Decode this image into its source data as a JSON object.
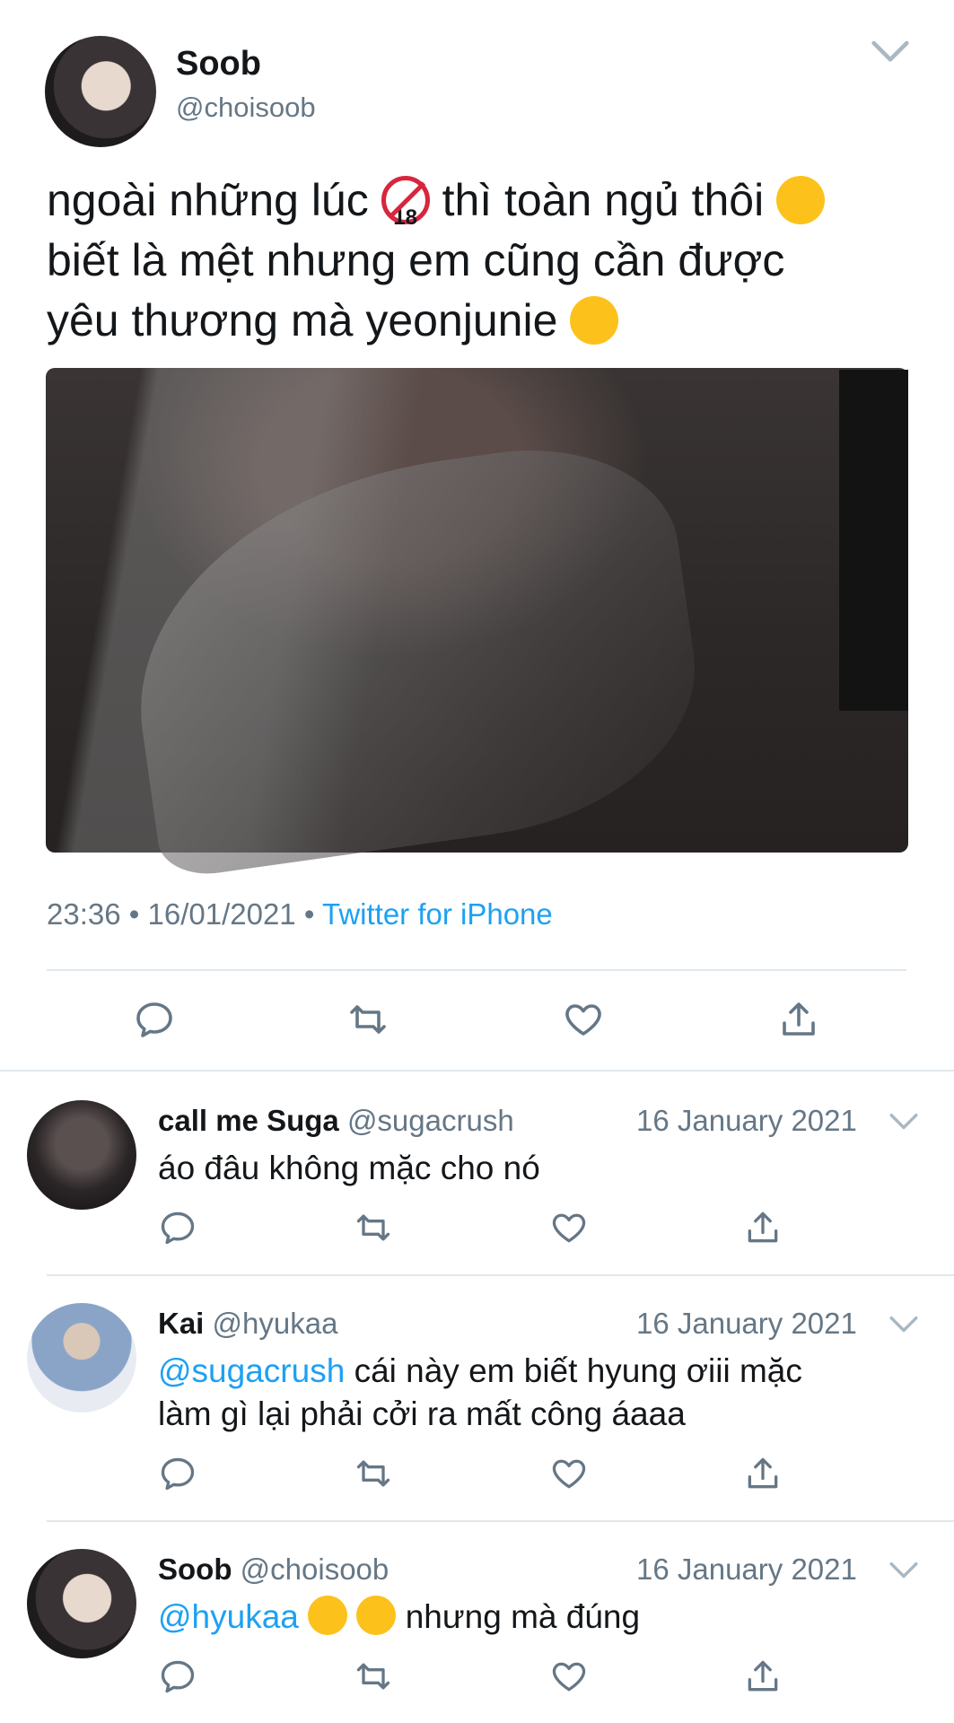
{
  "main_tweet": {
    "display_name": "Soob",
    "handle": "@choisoob",
    "text_line1_a": "ngoài những lúc",
    "text_line1_b": "thì toàn ngủ thôi",
    "text_line2": "biết là mệt nhưng em cũng cần được",
    "text_line3": "yêu thương mà yeonjunie",
    "emoji_18": "18",
    "time": "23:36",
    "date": "16/01/2021",
    "separator": "•",
    "source": "Twitter for iPhone"
  },
  "replies": [
    {
      "display_name": "call me Suga",
      "handle": "@sugacrush",
      "date": "16 January 2021",
      "mention": "",
      "text": "áo đâu không mặc cho nó"
    },
    {
      "display_name": "Kai",
      "handle": "@hyukaa",
      "date": "16 January 2021",
      "mention": "@sugacrush",
      "text_line1": "cái này em biết hyung ơiii mặc",
      "text_line2": "làm gì lại phải cởi ra mất công áaaa"
    },
    {
      "display_name": "Soob",
      "handle": "@choisoob",
      "date": "16 January 2021",
      "mention": "@hyukaa",
      "text": "nhưng mà đúng"
    }
  ],
  "colors": {
    "accent": "#1da1f2",
    "secondary_text": "#657786",
    "divider": "#e1e8ed",
    "icon": "#657786"
  },
  "icons": [
    "reply-icon",
    "retweet-icon",
    "like-icon",
    "share-icon",
    "chevron-down-icon"
  ]
}
